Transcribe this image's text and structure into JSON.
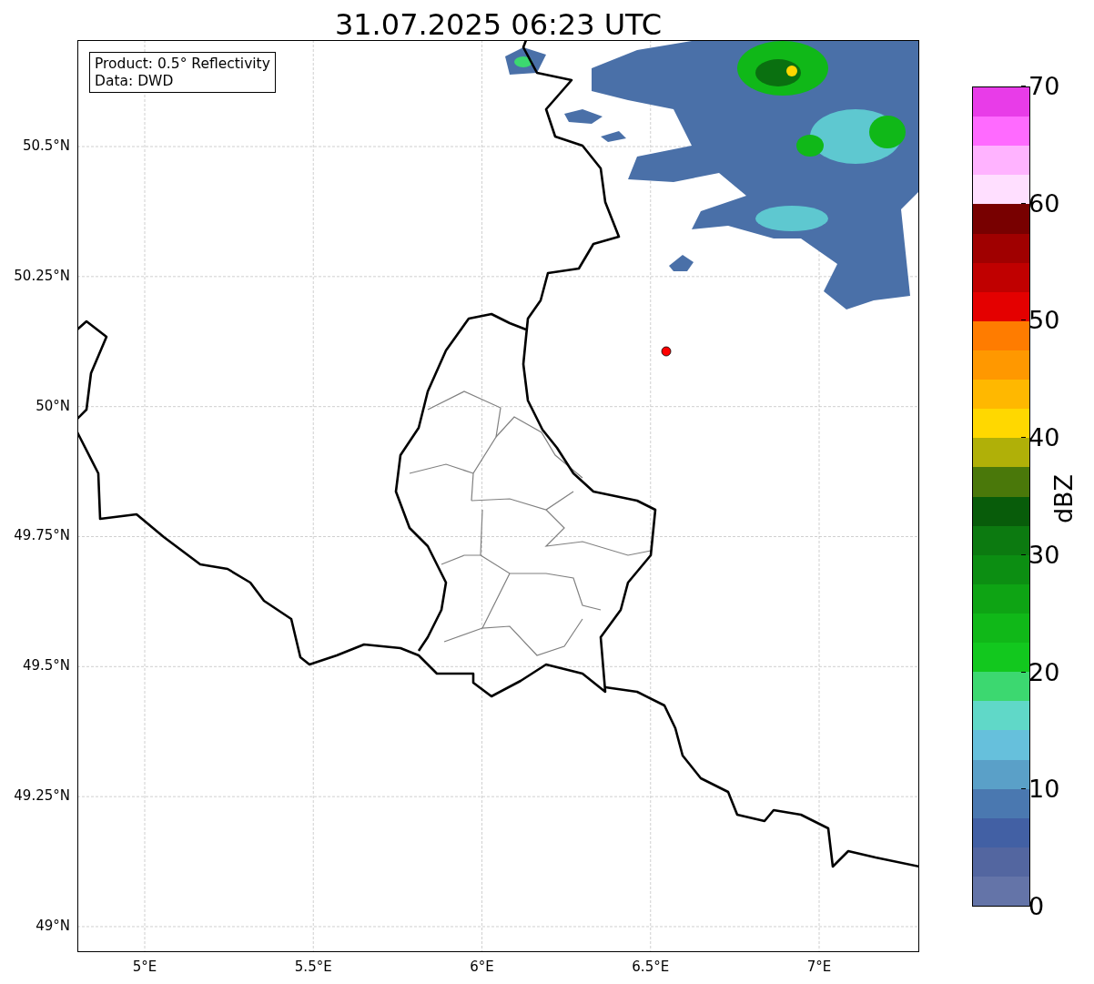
{
  "title": "31.07.2025 06:23 UTC",
  "info_box": {
    "lines": [
      "Product: 0.5° Reflectivity",
      "Data: DWD"
    ]
  },
  "map": {
    "lat_labels": [
      "50.5°N",
      "50.25°N",
      "50°N",
      "49.75°N",
      "49.5°N",
      "49.25°N",
      "49°N"
    ],
    "lon_labels": [
      "5°E",
      "5.5°E",
      "6°E",
      "6.5°E",
      "7°E"
    ]
  },
  "colorbar": {
    "label": "dBZ",
    "ticks": [
      "70",
      "60",
      "50",
      "40",
      "30",
      "20",
      "10",
      "0"
    ],
    "bands": [
      {
        "color": "#e83ce8"
      },
      {
        "color": "#ff6aff"
      },
      {
        "color": "#ffb3ff"
      },
      {
        "color": "#ffdfff"
      },
      {
        "color": "#780000"
      },
      {
        "color": "#a00000"
      },
      {
        "color": "#c00000"
      },
      {
        "color": "#e40000"
      },
      {
        "color": "#ff7c00"
      },
      {
        "color": "#ff9800"
      },
      {
        "color": "#ffb800"
      },
      {
        "color": "#ffd800"
      },
      {
        "color": "#b0b008"
      },
      {
        "color": "#4a780a"
      },
      {
        "color": "#085c0a"
      },
      {
        "color": "#0c7a10"
      },
      {
        "color": "#0c8e12"
      },
      {
        "color": "#0ea414"
      },
      {
        "color": "#10b818"
      },
      {
        "color": "#12c81e"
      },
      {
        "color": "#3cd870"
      },
      {
        "color": "#60d8c8"
      },
      {
        "color": "#66c0dc"
      },
      {
        "color": "#5aa0c8"
      },
      {
        "color": "#4a78b0"
      },
      {
        "color": "#4260a4"
      },
      {
        "color": "#5366a0"
      },
      {
        "color": "#6474a8"
      }
    ]
  }
}
